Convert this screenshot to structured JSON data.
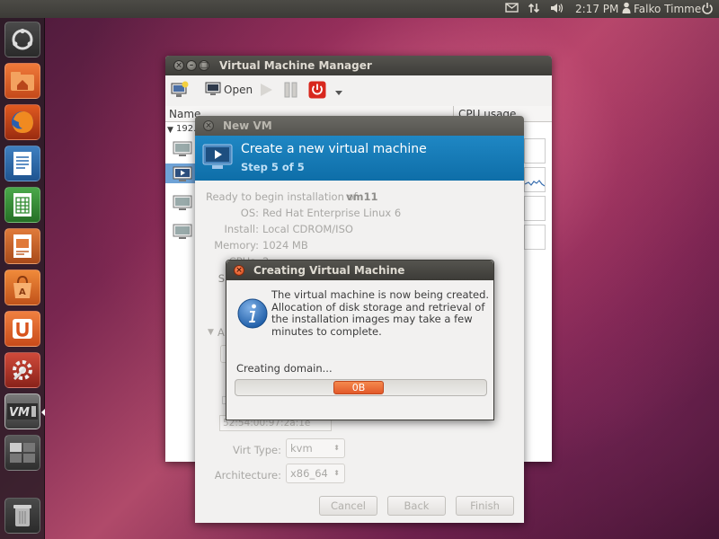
{
  "top_panel": {
    "clock": "2:17 PM",
    "user": "Falko Timme",
    "icons": [
      "mail-icon",
      "network-icon",
      "volume-icon",
      "user-icon",
      "power-icon"
    ]
  },
  "launcher": {
    "items": [
      "dash-icon",
      "home-folder-icon",
      "firefox-icon",
      "writer-icon",
      "calc-icon",
      "impress-icon",
      "software-center-icon",
      "ubuntu-one-icon",
      "system-settings-icon",
      "virt-manager-icon",
      "workspaces-icon",
      "trash-icon"
    ]
  },
  "vmm": {
    "title": "Virtual Machine Manager",
    "toolbar": {
      "open_label": "Open"
    },
    "list": {
      "col_name": "Name",
      "col_cpu": "CPU usage",
      "host": "192."
    }
  },
  "newvm": {
    "title": "New VM",
    "banner_title": "Create a new virtual machine",
    "banner_step": "Step 5 of 5",
    "ready_prefix": "Ready to begin installation of",
    "vm_name": "vm11",
    "os_label": "OS:",
    "os_value": "Red Hat Enterprise Linux 6",
    "install_label": "Install:",
    "install_value": "Local CDROM/ISO",
    "memory_label": "Memory:",
    "memory_value": "1024 MB",
    "cpus_label": "CPUs:",
    "cpus_value": "2",
    "storage_label": "S",
    "advanced_label": "A",
    "mac_value": "52:54:00:97:2a:1e",
    "virt_type_label": "Virt Type:",
    "virt_type_value": "kvm",
    "arch_label": "Architecture:",
    "arch_value": "x86_64",
    "cancel_label": "Cancel",
    "back_label": "Back",
    "finish_label": "Finish"
  },
  "creating": {
    "title": "Creating Virtual Machine",
    "message": "The virtual machine is now being created. Allocation of disk storage and retrieval of the installation images may take a few minutes to complete.",
    "status": "Creating domain...",
    "progress_text": "0B",
    "progress_fraction": 0.2
  },
  "colors": {
    "banner": "#1479b8",
    "progress": "#e9672f",
    "close_button": "#e0541f"
  }
}
